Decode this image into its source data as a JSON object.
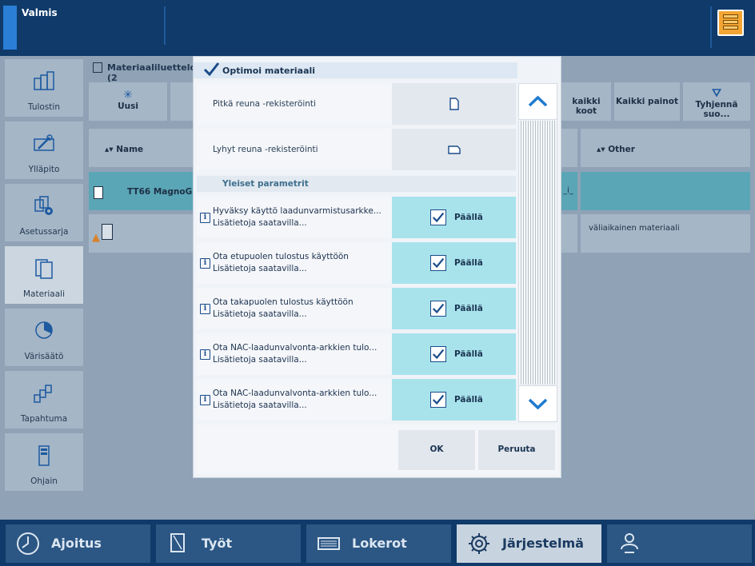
{
  "status": {
    "text": "Valmis"
  },
  "sidebar": {
    "items": [
      {
        "label": "Tulostin"
      },
      {
        "label": "Ylläpito"
      },
      {
        "label": "Asetussarja"
      },
      {
        "label": "Materiaali"
      },
      {
        "label": "Värisäätö"
      },
      {
        "label": "Tapahtuma"
      },
      {
        "label": "Ohjain"
      }
    ]
  },
  "background": {
    "panel_title": "Materiaaliluettelo (2",
    "toolbar": {
      "new": "Uusi",
      "all_sizes": "kaikki koot",
      "all_weights": "Kaikki painot",
      "clear": "Tyhjennä suo..."
    },
    "columns": {
      "name": "Name",
      "other": "Other"
    },
    "rows": [
      {
        "name": "TT66 MagnoGlos",
        "mid": "_i_",
        "other": ""
      },
      {
        "name": "",
        "mid": "",
        "other": "väliaikainen materiaali"
      }
    ]
  },
  "dialog": {
    "title": "Optimoi materiaali",
    "rows_top": [
      {
        "label": "Pitkä reuna -rekisteröinti"
      },
      {
        "label": "Lyhyt reuna -rekisteröinti"
      }
    ],
    "section": "Yleiset parametrit",
    "rows": [
      {
        "line1": "Hyväksy käyttö laadunvarmistusarkke...",
        "line2": "Lisätietoja saatavilla...",
        "value": "Päällä"
      },
      {
        "line1": "Ota etupuolen tulostus käyttöön",
        "line2": "Lisätietoja saatavilla...",
        "value": "Päällä"
      },
      {
        "line1": "Ota takapuolen tulostus käyttöön",
        "line2": "Lisätietoja saatavilla...",
        "value": "Päällä"
      },
      {
        "line1": "Ota NAC-laadunvalvonta-arkkien tulo...",
        "line2": "Lisätietoja saatavilla...",
        "value": "Päällä"
      },
      {
        "line1": "Ota NAC-laadunvalvonta-arkkien tulo...",
        "line2": "Lisätietoja saatavilla...",
        "value": "Päällä"
      }
    ],
    "ok": "OK",
    "cancel": "Peruuta"
  },
  "bottomnav": {
    "items": [
      {
        "label": "Ajoitus"
      },
      {
        "label": "Työt"
      },
      {
        "label": "Lokerot"
      },
      {
        "label": "Järjestelmä"
      },
      {
        "label": ""
      }
    ]
  },
  "colors": {
    "topbar": "#0f3a6a",
    "selected_row": "#a8e3ec",
    "accent": "#2a7ed6"
  }
}
